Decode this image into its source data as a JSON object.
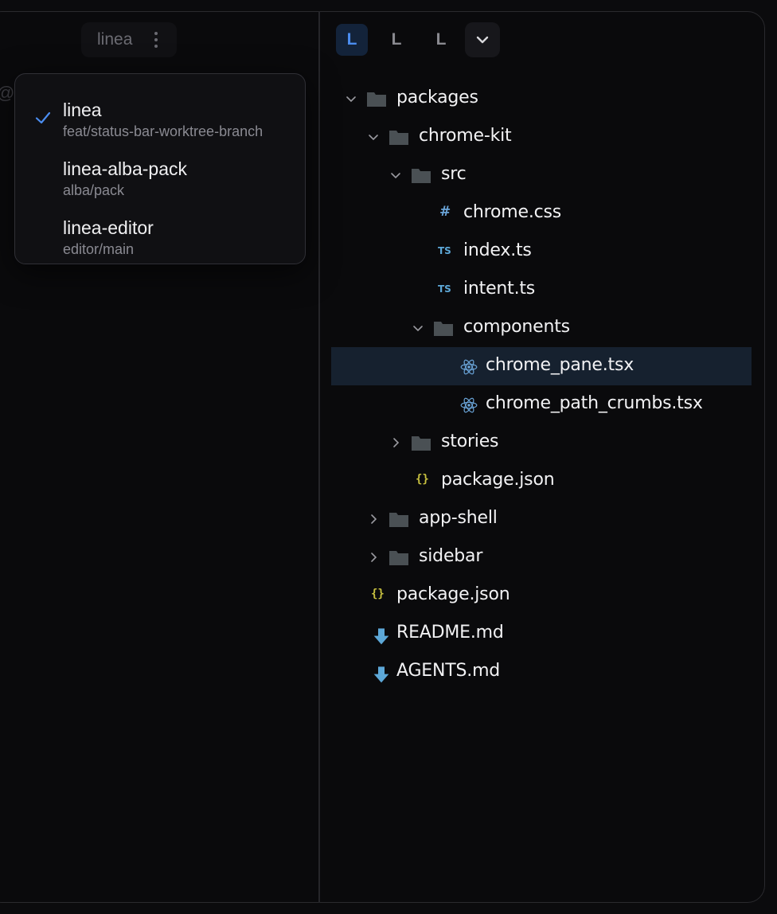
{
  "left_pane": {
    "workspace_chip": {
      "label": "linea"
    },
    "ghost_text": "@",
    "workspace_menu": {
      "items": [
        {
          "name": "linea",
          "branch": "feat/status-bar-worktree-branch",
          "selected": true
        },
        {
          "name": "linea-alba-pack",
          "branch": "alba/pack",
          "selected": false
        },
        {
          "name": "linea-editor",
          "branch": "editor/main",
          "selected": false
        }
      ]
    }
  },
  "right_pane": {
    "tabs": [
      {
        "label": "L",
        "active": true
      },
      {
        "label": "L",
        "active": false
      },
      {
        "label": "L",
        "active": false
      }
    ],
    "tree": [
      {
        "label": "packages",
        "type": "folder",
        "expanded": true
      },
      {
        "label": "chrome-kit",
        "type": "folder",
        "expanded": true
      },
      {
        "label": "src",
        "type": "folder",
        "expanded": true
      },
      {
        "label": "chrome.css",
        "type": "css",
        "glyph": "#"
      },
      {
        "label": "index.ts",
        "type": "ts",
        "glyph": "TS"
      },
      {
        "label": "intent.ts",
        "type": "ts",
        "glyph": "TS"
      },
      {
        "label": "components",
        "type": "folder",
        "expanded": true
      },
      {
        "label": "chrome_pane.tsx",
        "type": "react",
        "selected": true
      },
      {
        "label": "chrome_path_crumbs.tsx",
        "type": "react"
      },
      {
        "label": "stories",
        "type": "folder",
        "expanded": false
      },
      {
        "label": "package.json",
        "type": "json",
        "glyph": "{}"
      },
      {
        "label": "app-shell",
        "type": "folder",
        "expanded": false
      },
      {
        "label": "sidebar",
        "type": "folder",
        "expanded": false
      },
      {
        "label": "package.json",
        "type": "json",
        "glyph": "{}"
      },
      {
        "label": "README.md",
        "type": "markdown"
      },
      {
        "label": "AGENTS.md",
        "type": "markdown"
      }
    ]
  },
  "colors": {
    "accent": "#4b8df0",
    "selection": "#16212f",
    "folder": "#4a5054",
    "ts": "#5da8d8",
    "json": "#c9c240"
  }
}
